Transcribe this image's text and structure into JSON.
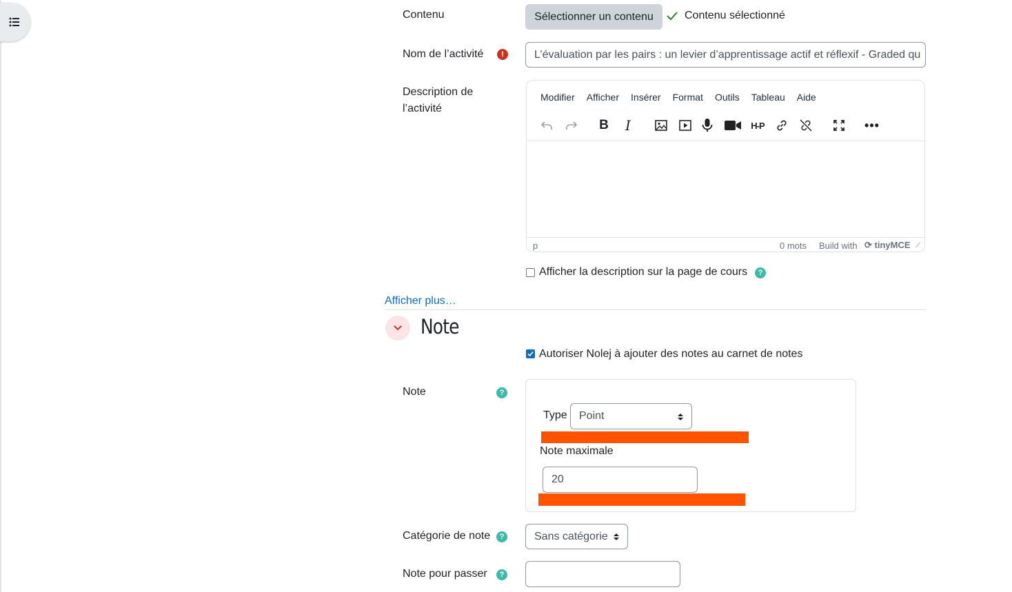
{
  "form": {
    "content_label": "Contenu",
    "select_content_button": "Sélectionner un contenu",
    "content_selected_text": "Contenu sélectionné",
    "activity_name_label": "Nom de l’activité",
    "activity_name_value": "L’évaluation par les pairs : un levier d’apprentissage actif et réflexif - Graded qu",
    "description_label_line1": "Description de",
    "description_label_line2": "l’activité",
    "show_description_label": "Afficher la description sur la page de cours",
    "show_more_link": "Afficher plus…"
  },
  "editor": {
    "menu": [
      "Modifier",
      "Afficher",
      "Insérer",
      "Format",
      "Outils",
      "Tableau",
      "Aide"
    ],
    "status_path": "p",
    "word_count": "0 mots",
    "build_with": "Build with",
    "brand": "tinyMCE"
  },
  "grade_section": {
    "title": "Note",
    "allow_grades_label": "Autoriser Nolej à ajouter des notes au carnet de notes",
    "grade_label": "Note",
    "type_label": "Type",
    "type_value": "Point",
    "max_grade_label": "Note maximale",
    "max_grade_value": "20",
    "category_label": "Catégorie de note",
    "category_value": "Sans catégorie",
    "pass_grade_label": "Note pour passer",
    "pass_grade_value": ""
  },
  "colors": {
    "accent": "#0f6cbf",
    "help": "#3fb9a9",
    "error": "#ca3120",
    "redaction": "#ff5300"
  },
  "icons": [
    "list-icon",
    "check-icon",
    "error-icon",
    "undo-icon",
    "redo-icon",
    "bold-icon",
    "italic-icon",
    "image-icon",
    "media-icon",
    "microphone-icon",
    "video-icon",
    "h5p-icon",
    "link-icon",
    "unlink-icon",
    "fullscreen-icon",
    "more-icon",
    "help-icon",
    "chevron-down-icon",
    "select-arrows-icon"
  ]
}
